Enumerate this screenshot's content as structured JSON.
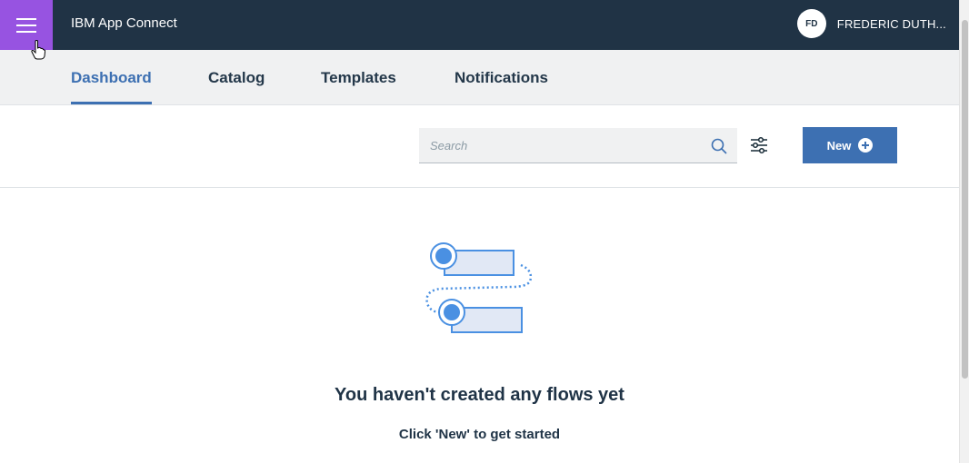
{
  "header": {
    "app_title": "IBM App Connect",
    "user_initials": "FD",
    "user_name": "FREDERIC DUTH..."
  },
  "tabs": [
    {
      "label": "Dashboard",
      "active": true
    },
    {
      "label": "Catalog",
      "active": false
    },
    {
      "label": "Templates",
      "active": false
    },
    {
      "label": "Notifications",
      "active": false
    }
  ],
  "toolbar": {
    "search_placeholder": "Search",
    "search_value": "",
    "new_label": "New"
  },
  "empty_state": {
    "title": "You haven't created any flows yet",
    "subtitle": "Click 'New' to get started"
  },
  "colors": {
    "header_bg": "#203345",
    "menu_button": "#9753e1",
    "accent": "#3d70b2"
  }
}
